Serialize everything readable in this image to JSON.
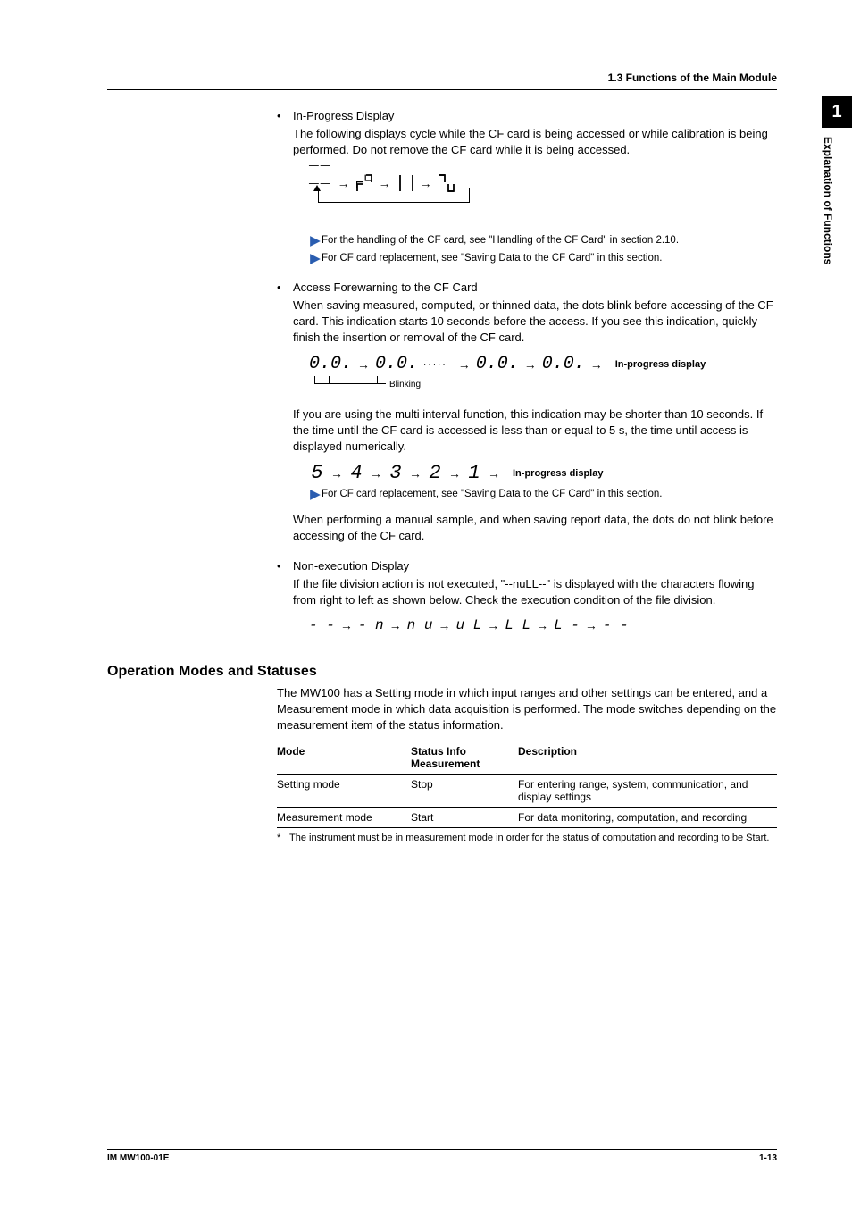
{
  "header": {
    "section": "1.3  Functions of the Main Module"
  },
  "side": {
    "num": "1",
    "label": "Explanation of Functions"
  },
  "items": {
    "inprog": {
      "title": "In-Progress Display",
      "body": "The following displays cycle while the CF card is being accessed or while calibration is being performed. Do not remove the CF card while it is being accessed.",
      "ref1": "For the handling of the CF card, see \"Handling of the CF Card\" in section 2.10.",
      "ref2": "For CF card replacement, see \"Saving Data to the CF Card\" in this section."
    },
    "access": {
      "title": "Access Forewarning to the CF Card",
      "body": "When saving measured, computed, or thinned data, the dots blink before accessing of the CF card. This indication starts 10 seconds before the access. If you see this indication, quickly finish the insertion or removal of the CF card.",
      "label_inprog": "In-progress display",
      "label_blinking": "Blinking",
      "body2": "If you are using the multi interval function, this indication may be shorter than 10 seconds. If the time until the CF card is accessed is less than or equal to 5 s, the time until access is displayed numerically.",
      "count_label": "In-progress display",
      "ref": "For CF card replacement, see \"Saving Data to the CF Card\" in this section.",
      "body3": "When performing a manual sample, and when saving report data, the dots do not blink before accessing of the CF card."
    },
    "nonexec": {
      "title": "Non-execution Display",
      "body": "If the file division action is not executed, \"--nuLL--\" is displayed with the characters flowing from right to left as shown below. Check the execution condition of the file division."
    }
  },
  "section2": {
    "heading": "Operation Modes and Statuses",
    "intro": "The MW100 has a Setting mode in which input ranges and other settings can be entered, and a Measurement mode in which data acquisition is performed. The mode switches depending on the measurement item of the status information.",
    "table": {
      "h_mode": "Mode",
      "h_status1": "Status Info",
      "h_status2": "Measurement",
      "h_desc": "Description",
      "rows": [
        {
          "mode": "Setting mode",
          "status": "Stop",
          "desc": "For entering range, system, communication, and display settings"
        },
        {
          "mode": "Measurement mode",
          "status": "Start",
          "desc": "For data monitoring, computation, and recording"
        }
      ]
    },
    "footnote": "The instrument must be in measurement mode in order for the status of computation and recording to be Start."
  },
  "countdown": {
    "d5": "5",
    "d4": "4",
    "d3": "3",
    "d2": "2",
    "d1": "1"
  },
  "scroll": {
    "s1": "- -",
    "s2": "- n",
    "s3": "n u",
    "s4": "u L",
    "s5": "L L",
    "s6": "L -",
    "s7": "- -"
  },
  "seg_pairs": {
    "p1": "0.0.",
    "p2": "0.0.",
    "p3": "0.0.",
    "p4": "0.0."
  },
  "footer": {
    "left": "IM MW100-01E",
    "right": "1-13"
  },
  "glyphs": {
    "bullet": "•",
    "arrow": "→",
    "ast": "*",
    "dots": "·····"
  }
}
